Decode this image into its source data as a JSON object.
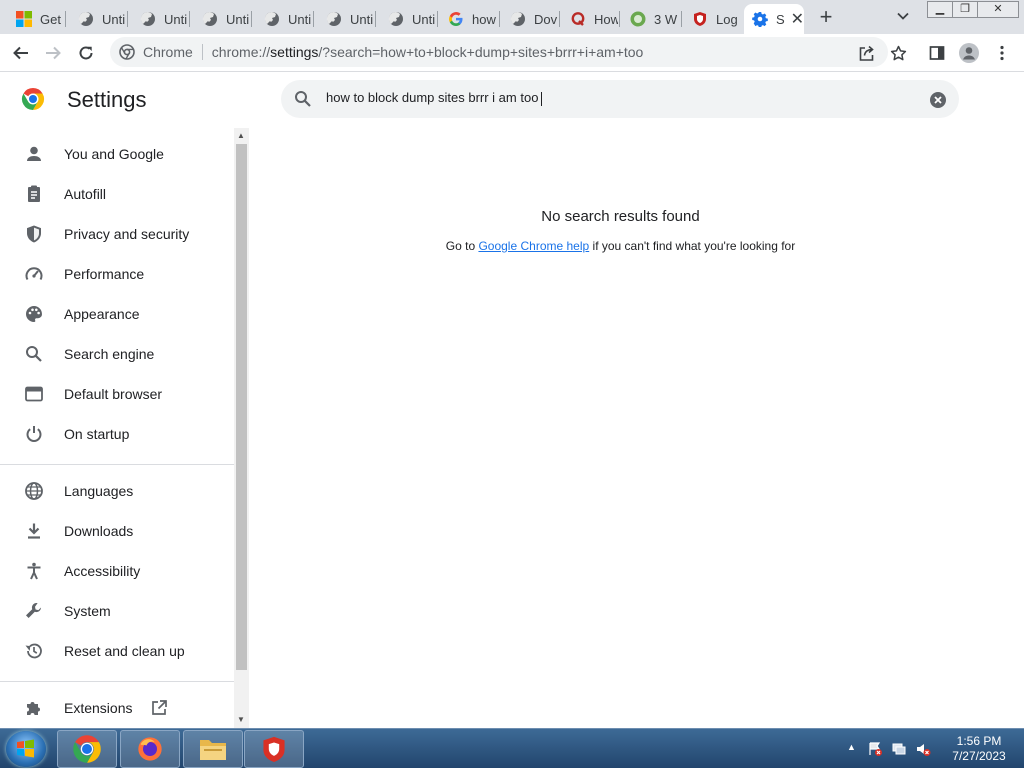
{
  "browser": {
    "tabs": [
      {
        "title": "Get",
        "favicon": "windows-logo-icon"
      },
      {
        "title": "Unti",
        "favicon": "globe-icon"
      },
      {
        "title": "Unti",
        "favicon": "globe-icon"
      },
      {
        "title": "Unti",
        "favicon": "globe-icon"
      },
      {
        "title": "Unti",
        "favicon": "globe-icon"
      },
      {
        "title": "Unti",
        "favicon": "globe-icon"
      },
      {
        "title": "Unti",
        "favicon": "globe-icon"
      },
      {
        "title": "how",
        "favicon": "google-icon"
      },
      {
        "title": "Dov",
        "favicon": "globe-icon"
      },
      {
        "title": "How",
        "favicon": "quora-icon"
      },
      {
        "title": "3 W",
        "favicon": "site-icon"
      },
      {
        "title": "Log",
        "favicon": "shield-icon"
      },
      {
        "title": "S",
        "favicon": "gear-icon",
        "active": true
      }
    ],
    "omnibox": {
      "chip_label": "Chrome",
      "url_prefix": "chrome://",
      "url_host": "settings",
      "url_rest": "/?search=how+to+block+dump+sites+brrr+i+am+too"
    }
  },
  "settings": {
    "title": "Settings",
    "search_value": "how to block dump sites brrr i am too",
    "nav": [
      {
        "label": "You and Google",
        "icon": "person-icon"
      },
      {
        "label": "Autofill",
        "icon": "clipboard-icon"
      },
      {
        "label": "Privacy and security",
        "icon": "shield-icon"
      },
      {
        "label": "Performance",
        "icon": "speedometer-icon"
      },
      {
        "label": "Appearance",
        "icon": "palette-icon"
      },
      {
        "label": "Search engine",
        "icon": "search-icon"
      },
      {
        "label": "Default browser",
        "icon": "browser-window-icon"
      },
      {
        "label": "On startup",
        "icon": "power-icon"
      },
      {
        "label": "Languages",
        "icon": "globe-icon"
      },
      {
        "label": "Downloads",
        "icon": "download-icon"
      },
      {
        "label": "Accessibility",
        "icon": "accessibility-icon"
      },
      {
        "label": "System",
        "icon": "wrench-icon"
      },
      {
        "label": "Reset and clean up",
        "icon": "history-icon"
      },
      {
        "label": "Extensions",
        "icon": "puzzle-icon"
      }
    ],
    "results": {
      "empty_title": "No search results found",
      "help_prefix": "Go to ",
      "help_link": "Google Chrome help",
      "help_suffix": " if you can't find what you're looking for"
    }
  },
  "taskbar": {
    "time": "1:56 PM",
    "date": "7/27/2023"
  },
  "colors": {
    "accent": "#1a73e8",
    "icon_gray": "#5f6368",
    "tab_strip": "#dee1e6"
  }
}
